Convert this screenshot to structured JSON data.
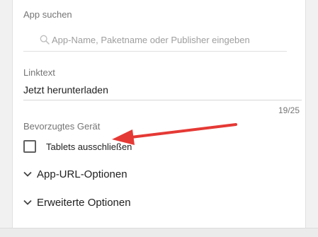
{
  "app_search": {
    "label": "App suchen",
    "placeholder": "App-Name, Paketname oder Publisher eingeben",
    "value": ""
  },
  "linktext": {
    "label": "Linktext",
    "value": "Jetzt herunterladen",
    "char_count": "19/25"
  },
  "preferred_device": {
    "label": "Bevorzugtes Gerät",
    "checkbox_label": "Tablets ausschließen",
    "checked": false
  },
  "expanders": {
    "app_url": "App-URL-Optionen",
    "advanced": "Erweiterte Optionen"
  },
  "annotation": {
    "arrow_color": "#e53935"
  },
  "colors": {
    "accent_text": "#212121",
    "muted_text": "#757575",
    "divider": "#e0e0e0"
  }
}
